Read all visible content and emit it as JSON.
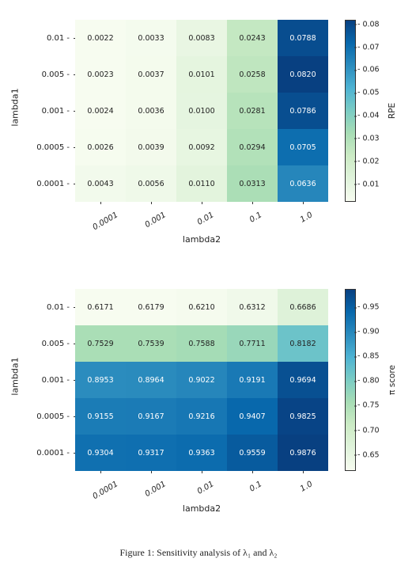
{
  "chart_data": [
    {
      "type": "heatmap",
      "xlabel": "lambda2",
      "ylabel": "lambda1",
      "cbar_label": "RPE",
      "x_categories": [
        "0.0001",
        "0.001",
        "0.01",
        "0.1",
        "1.0"
      ],
      "y_categories": [
        "0.01",
        "0.005",
        "0.001",
        "0.0005",
        "0.0001"
      ],
      "values": [
        [
          0.0022,
          0.0033,
          0.0083,
          0.0243,
          0.0788
        ],
        [
          0.0023,
          0.0037,
          0.0101,
          0.0258,
          0.082
        ],
        [
          0.0024,
          0.0036,
          0.01,
          0.0281,
          0.0786
        ],
        [
          0.0026,
          0.0039,
          0.0092,
          0.0294,
          0.0705
        ],
        [
          0.0043,
          0.0056,
          0.011,
          0.0313,
          0.0636
        ]
      ],
      "vmin": 0.0022,
      "vmax": 0.082,
      "cbar_ticks": [
        0.01,
        0.02,
        0.03,
        0.04,
        0.05,
        0.06,
        0.07,
        0.08
      ],
      "colormap": "GnBu"
    },
    {
      "type": "heatmap",
      "xlabel": "lambda2",
      "ylabel": "lambda1",
      "cbar_label": "π score",
      "x_categories": [
        "0.0001",
        "0.001",
        "0.01",
        "0.1",
        "1.0"
      ],
      "y_categories": [
        "0.01",
        "0.005",
        "0.001",
        "0.0005",
        "0.0001"
      ],
      "values": [
        [
          0.6171,
          0.6179,
          0.621,
          0.6312,
          0.6686
        ],
        [
          0.7529,
          0.7539,
          0.7588,
          0.7711,
          0.8182
        ],
        [
          0.8953,
          0.8964,
          0.9022,
          0.9191,
          0.9694
        ],
        [
          0.9155,
          0.9167,
          0.9216,
          0.9407,
          0.9825
        ],
        [
          0.9304,
          0.9317,
          0.9363,
          0.9559,
          0.9876
        ]
      ],
      "vmin": 0.6171,
      "vmax": 0.9876,
      "cbar_ticks": [
        0.65,
        0.7,
        0.75,
        0.8,
        0.85,
        0.9,
        0.95
      ],
      "colormap": "GnBu"
    }
  ],
  "caption": "Figure 1: Sensitivity analysis of λ₁ and λ₂"
}
